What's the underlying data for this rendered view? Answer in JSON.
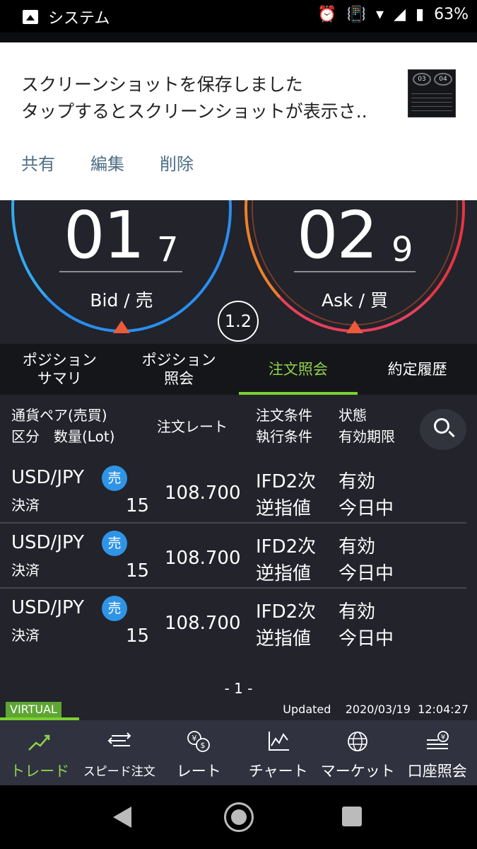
{
  "status_bar": {
    "app_label": "システム",
    "battery": "63%"
  },
  "notification": {
    "line1": "スクリーンショットを保存しました",
    "line2": "タップするとスクリーンショットが表示さ..",
    "thumb_left": "03",
    "thumb_right": "04",
    "actions": [
      "共有",
      "編集",
      "削除"
    ]
  },
  "rates": {
    "bid": {
      "big": "01",
      "small": "7",
      "label": "Bid / 売"
    },
    "ask": {
      "big": "02",
      "small": "9",
      "label": "Ask / 買"
    },
    "spread": "1.2"
  },
  "tabs": [
    {
      "label": "ポジション\nサマリ",
      "active": false
    },
    {
      "label": "ポジション\n照会",
      "active": false
    },
    {
      "label": "注文照会",
      "active": true
    },
    {
      "label": "約定履歴",
      "active": false
    }
  ],
  "table_header": {
    "col1_line1": "通貨ペア(売買)",
    "col1_line2": "区分　数量(Lot)",
    "col2": "注文レート",
    "col3_line1": "注文条件",
    "col3_line2": "執行条件",
    "col4_line1": "状態",
    "col4_line2": "有効期限"
  },
  "orders": [
    {
      "pair": "USD/JPY",
      "side": "売",
      "kubun": "決済",
      "qty": "15",
      "rate": "108.700",
      "cond1": "IFD2次",
      "cond2": "逆指値",
      "status": "有効",
      "expiry": "今日中"
    },
    {
      "pair": "USD/JPY",
      "side": "売",
      "kubun": "決済",
      "qty": "15",
      "rate": "108.700",
      "cond1": "IFD2次",
      "cond2": "逆指値",
      "status": "有効",
      "expiry": "今日中"
    },
    {
      "pair": "USD/JPY",
      "side": "売",
      "kubun": "決済",
      "qty": "15",
      "rate": "108.700",
      "cond1": "IFD2次",
      "cond2": "逆指値",
      "status": "有効",
      "expiry": "今日中"
    }
  ],
  "pagination": "- 1 -",
  "footer": {
    "virtual": "VIRTUAL",
    "updated_label": "Updated",
    "updated_date": "2020/03/19",
    "updated_time": "12:04:27"
  },
  "nav": [
    {
      "label": "トレード",
      "icon": "trade-chart-icon",
      "active": true
    },
    {
      "label": "スピード注文",
      "icon": "speed-order-icon",
      "active": false
    },
    {
      "label": "レート",
      "icon": "rate-currency-icon",
      "active": false
    },
    {
      "label": "チャート",
      "icon": "chart-icon",
      "active": false
    },
    {
      "label": "マーケット",
      "icon": "globe-icon",
      "active": false
    },
    {
      "label": "口座照会",
      "icon": "account-icon",
      "active": false
    }
  ],
  "colors": {
    "accent_green": "#7bd12f",
    "bid_blue": "#2a8ff0",
    "ask_red": "#e8353f",
    "sell_badge": "#2f94e6"
  }
}
